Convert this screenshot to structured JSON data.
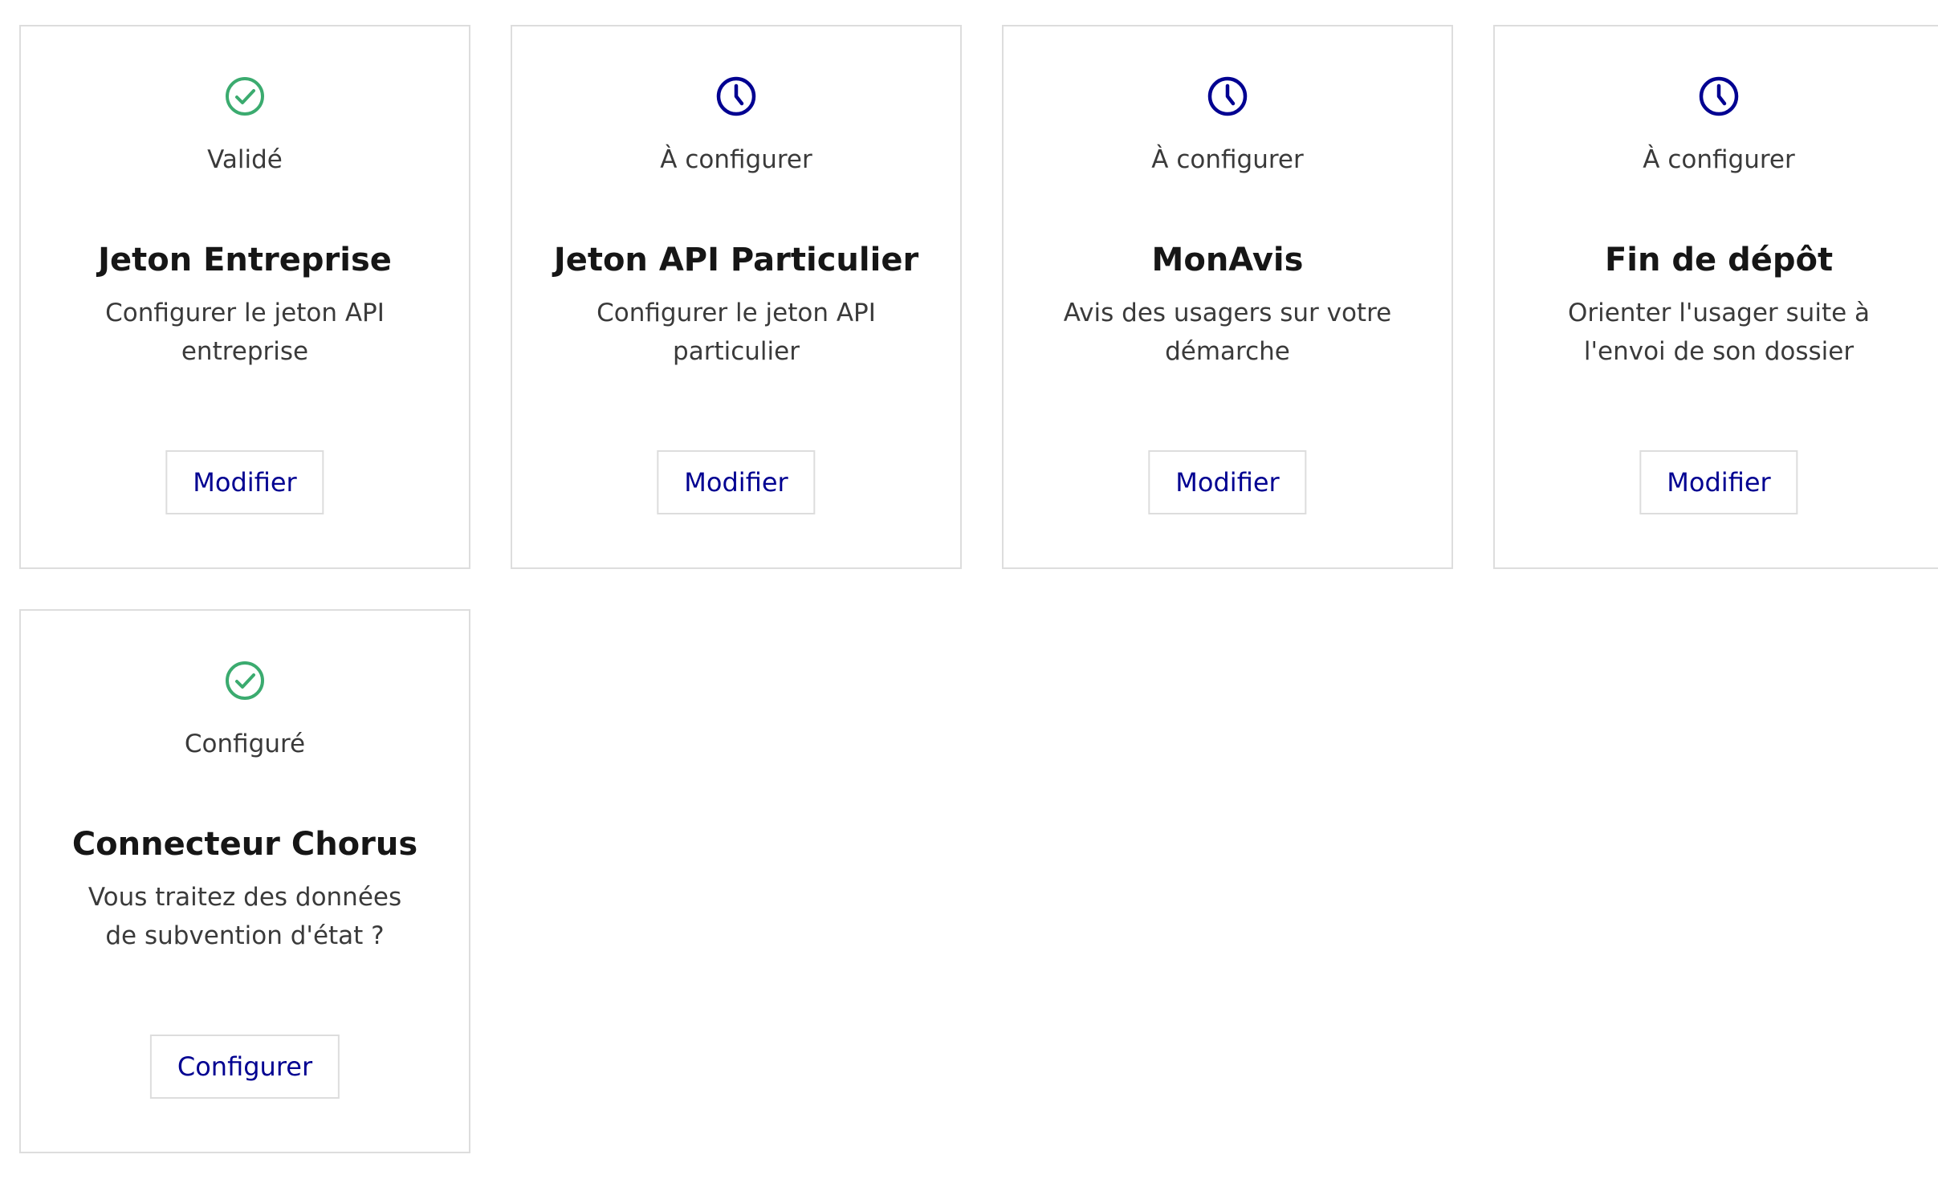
{
  "colors": {
    "success": "#3bab6f",
    "pending": "#000091",
    "border": "#dddddd",
    "action_text": "#000091"
  },
  "cards": [
    {
      "status_icon": "check-circle-icon",
      "status": "Validé",
      "title": "Jeton Entreprise",
      "description": "Configurer le jeton API entreprise",
      "button": "Modifier"
    },
    {
      "status_icon": "clock-icon",
      "status": "À configurer",
      "title": "Jeton API Particulier",
      "description": "Configurer le jeton API particulier",
      "button": "Modifier"
    },
    {
      "status_icon": "clock-icon",
      "status": "À configurer",
      "title": "MonAvis",
      "description": "Avis des usagers sur votre démarche",
      "button": "Modifier"
    },
    {
      "status_icon": "clock-icon",
      "status": "À configurer",
      "title": "Fin de dépôt",
      "description": "Orienter l'usager suite à l'envoi de son dossier",
      "button": "Modifier"
    },
    {
      "status_icon": "check-circle-icon",
      "status": "Configuré",
      "title": "Connecteur Chorus",
      "description": "Vous traitez des données de subvention d'état ?",
      "button": "Configurer"
    }
  ]
}
